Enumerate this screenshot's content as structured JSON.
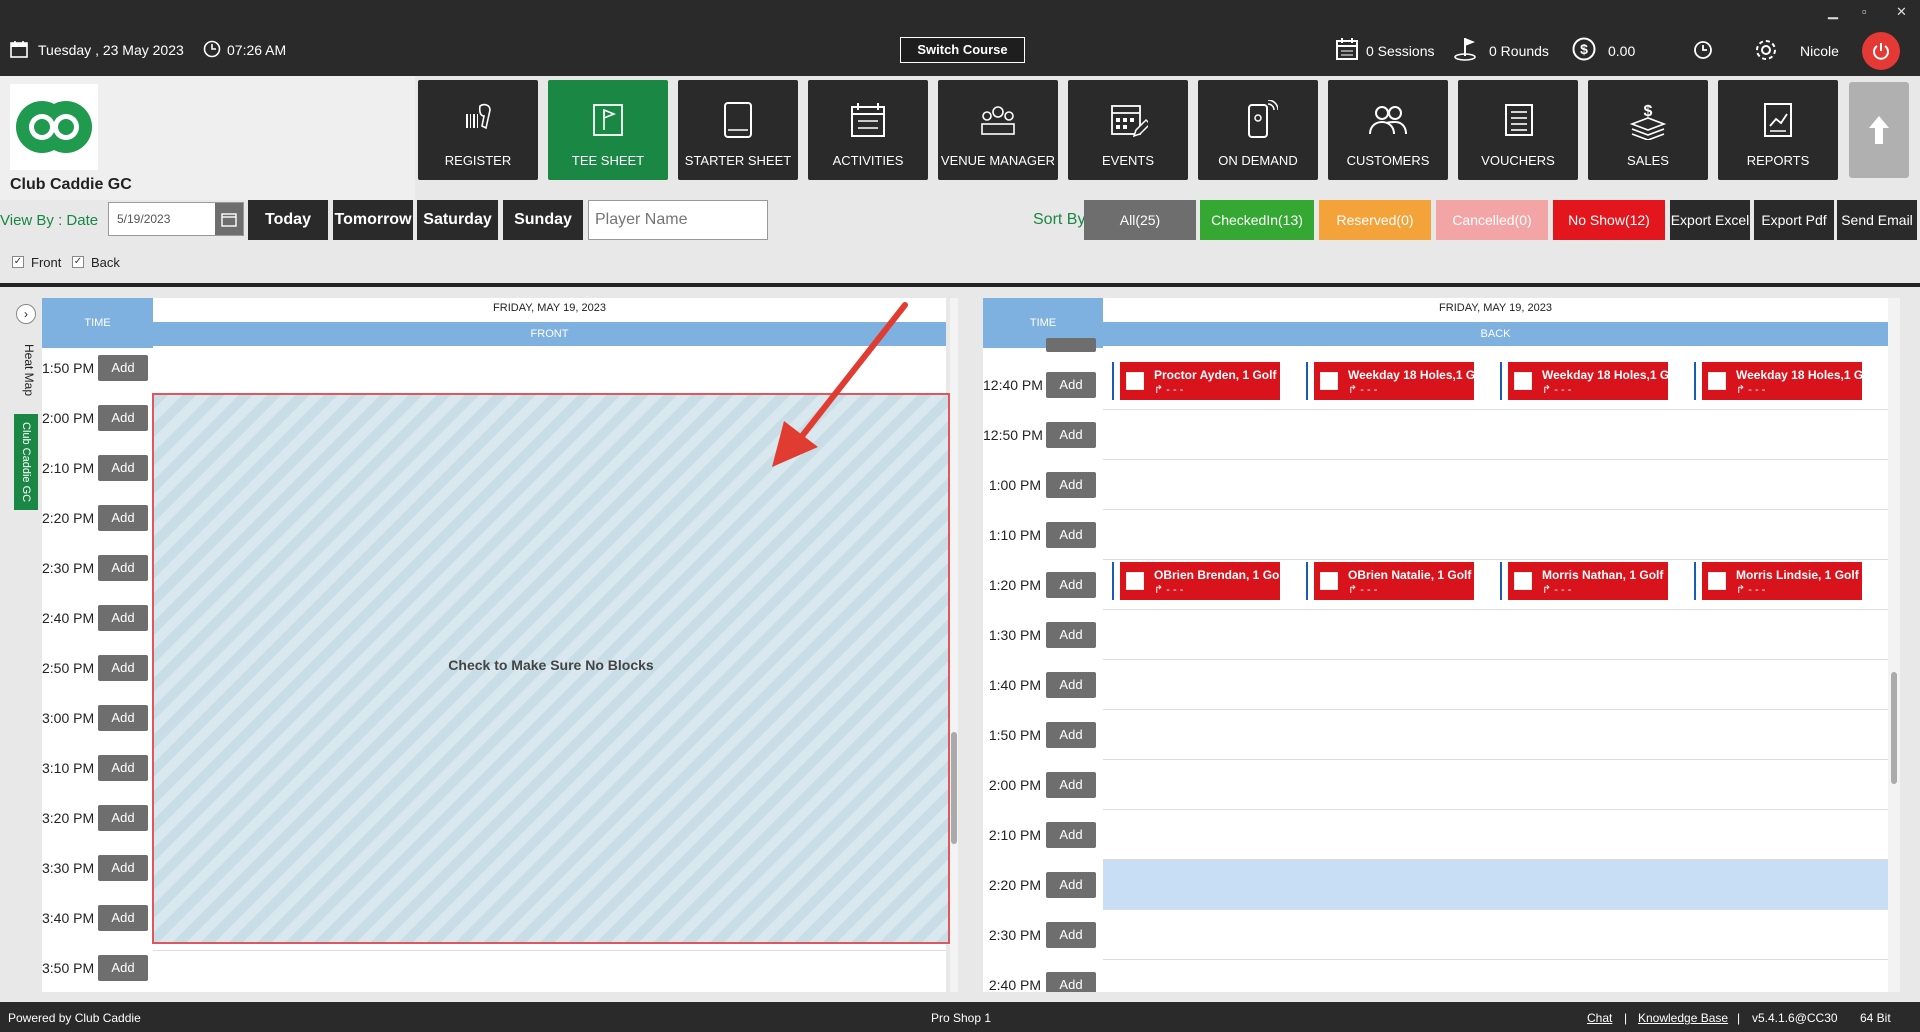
{
  "topbar": {
    "date": "Tuesday ,  23 May 2023",
    "time": "07:26 AM",
    "switch_course": "Switch Course",
    "sessions": "0 Sessions",
    "rounds": "0 Rounds",
    "amount": "0.00",
    "user": "Nicole",
    "win_min": "▁",
    "win_max": "▫",
    "win_close": "✕"
  },
  "club": {
    "name": "Club Caddie GC"
  },
  "nav": [
    {
      "label": "REGISTER",
      "icon": "barcode-scanner-icon"
    },
    {
      "label": "TEE SHEET",
      "icon": "tee-sheet-icon",
      "active": true
    },
    {
      "label": "STARTER SHEET",
      "icon": "tablet-icon"
    },
    {
      "label": "ACTIVITIES",
      "icon": "activities-icon"
    },
    {
      "label": "VENUE MANAGER",
      "icon": "venue-icon"
    },
    {
      "label": "EVENTS",
      "icon": "calendar-edit-icon"
    },
    {
      "label": "ON DEMAND",
      "icon": "mobile-icon"
    },
    {
      "label": "CUSTOMERS",
      "icon": "customers-icon"
    },
    {
      "label": "VOUCHERS",
      "icon": "vouchers-icon"
    },
    {
      "label": "SALES",
      "icon": "sales-icon"
    },
    {
      "label": "REPORTS",
      "icon": "reports-icon"
    }
  ],
  "filter": {
    "view_by": "View By : Date",
    "date_value": "5/19/2023",
    "today": "Today",
    "tomorrow": "Tomorrow",
    "saturday": "Saturday",
    "sunday": "Sunday",
    "player_placeholder": "Player Name",
    "sort_by": "Sort By",
    "front": "Front",
    "back": "Back"
  },
  "sort_buttons": [
    {
      "label": "All(25)",
      "color": "#6e6e6e"
    },
    {
      "label": "CheckedIn(13)",
      "color": "#34a832"
    },
    {
      "label": "Reserved(0)",
      "color": "#f4a23a"
    },
    {
      "label": "Cancelled(0)",
      "color": "#f3a4a4"
    },
    {
      "label": "No Show(12)",
      "color": "#e2161c"
    },
    {
      "label": "Export Excel",
      "color": "#2b2a2a"
    },
    {
      "label": "Export Pdf",
      "color": "#2b2a2a"
    },
    {
      "label": "Send Email",
      "color": "#2b2a2a"
    }
  ],
  "side_tabs": {
    "heat_map": "Heat Map",
    "club": "Club Caddie GC"
  },
  "front": {
    "time_hdr": "TIME",
    "date_hdr": "FRIDAY, MAY 19, 2023",
    "course_hdr": "FRONT",
    "block_label": "Check to Make Sure No Blocks",
    "times": [
      "1:50 PM",
      "2:00 PM",
      "2:10 PM",
      "2:20 PM",
      "2:30 PM",
      "2:40 PM",
      "2:50 PM",
      "3:00 PM",
      "3:10 PM",
      "3:20 PM",
      "3:30 PM",
      "3:40 PM",
      "3:50 PM"
    ]
  },
  "back": {
    "time_hdr": "TIME",
    "date_hdr": "FRIDAY, MAY 19, 2023",
    "course_hdr": "BACK",
    "times": [
      "12:40 PM",
      "12:50 PM",
      "1:00 PM",
      "1:10 PM",
      "1:20 PM",
      "1:30 PM",
      "1:40 PM",
      "1:50 PM",
      "2:00 PM",
      "2:10 PM",
      "2:20 PM",
      "2:30 PM",
      "2:40 PM"
    ],
    "row_1240": [
      "Proctor Ayden, 1 Golf",
      "Weekday 18 Holes,1 G",
      "Weekday 18 Holes,1 G",
      "Weekday 18 Holes,1 G"
    ],
    "row_120": [
      "OBrien Brendan, 1 Go",
      "OBrien Natalie, 1 Golf",
      "Morris Nathan, 1 Golf",
      "Morris Lindsie, 1 Golf"
    ],
    "card_sub": "- - -"
  },
  "add_label": "Add",
  "footer": {
    "powered": "Powered by Club Caddie",
    "shop": "Pro Shop 1",
    "chat": "Chat",
    "sep": "|",
    "kb": "Knowledge Base",
    "version": "v5.4.1.6@CC30",
    "bit": "64 Bit"
  }
}
